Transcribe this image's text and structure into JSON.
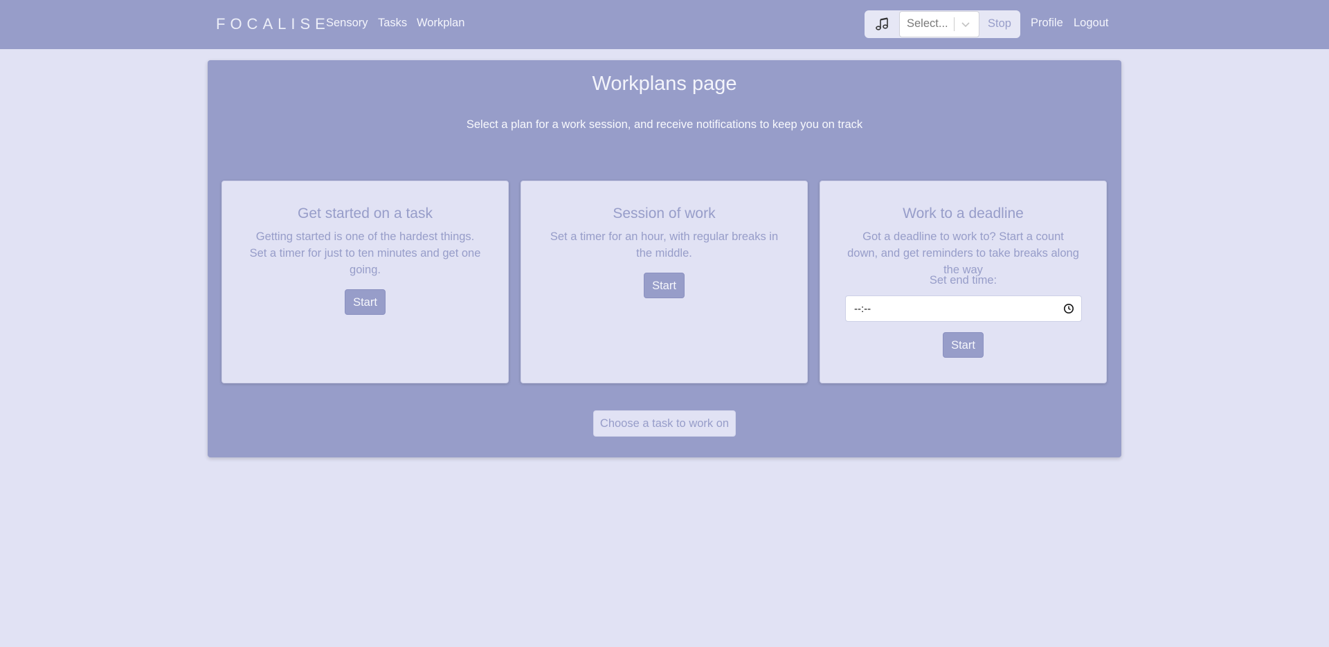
{
  "nav": {
    "brand": "FOCALISE",
    "links": [
      "Sensory",
      "Tasks",
      "Workplan"
    ],
    "music": {
      "icon": "music-note-icon",
      "select_placeholder": "Select...",
      "stop_label": "Stop"
    },
    "profile_label": "Profile",
    "logout_label": "Logout"
  },
  "main": {
    "title": "Workplans page",
    "subtitle": "Select a plan for a work session, and receive notifications to keep you on track",
    "cards": [
      {
        "title": "Get started on a task",
        "text": "Getting started is one of the hardest things. Set a timer for just to ten minutes and get one going.",
        "button": "Start"
      },
      {
        "title": "Session of work",
        "text": "Set a timer for an hour, with regular breaks in the middle.",
        "button": "Start"
      },
      {
        "title": "Work to a deadline",
        "text": "Got a deadline to work to? Start a count down, and get reminders to take breaks along the way",
        "end_time_label": "Set end time:",
        "end_time_value": "--:--",
        "button": "Start"
      }
    ],
    "choose_task_label": "Choose a task to work on"
  },
  "colors": {
    "page_background": "#e1e2f4",
    "accent": "#979dc9"
  }
}
